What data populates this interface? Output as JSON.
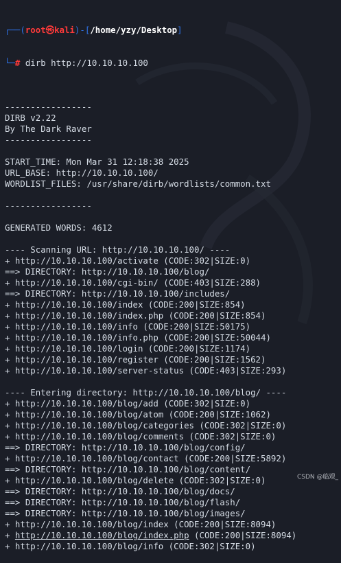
{
  "prompt": {
    "corner_top": "┌──(",
    "user": "root",
    "at_symbol": "㉿",
    "host": "kali",
    "sep": ")-[",
    "path": "/home/yzy/Desktop",
    "close": "]",
    "corner_bottom": "└─",
    "hash": "# ",
    "command": "dirb http://10.10.10.100"
  },
  "output": [
    "",
    "-----------------",
    "DIRB v2.22",
    "By The Dark Raver",
    "-----------------",
    "",
    "START_TIME: Mon Mar 31 12:18:38 2025",
    "URL_BASE: http://10.10.10.100/",
    "WORDLIST_FILES: /usr/share/dirb/wordlists/common.txt",
    "",
    "-----------------",
    "",
    "GENERATED WORDS: 4612",
    "",
    "---- Scanning URL: http://10.10.10.100/ ----",
    "+ http://10.10.10.100/activate (CODE:302|SIZE:0)",
    "==> DIRECTORY: http://10.10.10.100/blog/",
    "+ http://10.10.10.100/cgi-bin/ (CODE:403|SIZE:288)",
    "==> DIRECTORY: http://10.10.10.100/includes/",
    "+ http://10.10.10.100/index (CODE:200|SIZE:854)",
    "+ http://10.10.10.100/index.php (CODE:200|SIZE:854)",
    "+ http://10.10.10.100/info (CODE:200|SIZE:50175)",
    "+ http://10.10.10.100/info.php (CODE:200|SIZE:50044)",
    "+ http://10.10.10.100/login (CODE:200|SIZE:1174)",
    "+ http://10.10.10.100/register (CODE:200|SIZE:1562)",
    "+ http://10.10.10.100/server-status (CODE:403|SIZE:293)",
    "",
    "---- Entering directory: http://10.10.10.100/blog/ ----",
    "+ http://10.10.10.100/blog/add (CODE:302|SIZE:0)",
    "+ http://10.10.10.100/blog/atom (CODE:200|SIZE:1062)",
    "+ http://10.10.10.100/blog/categories (CODE:302|SIZE:0)",
    "+ http://10.10.10.100/blog/comments (CODE:302|SIZE:0)",
    "==> DIRECTORY: http://10.10.10.100/blog/config/",
    "+ http://10.10.10.100/blog/contact (CODE:200|SIZE:5892)",
    "==> DIRECTORY: http://10.10.10.100/blog/content/",
    "+ http://10.10.10.100/blog/delete (CODE:302|SIZE:0)",
    "==> DIRECTORY: http://10.10.10.100/blog/docs/",
    "==> DIRECTORY: http://10.10.10.100/blog/flash/",
    "==> DIRECTORY: http://10.10.10.100/blog/images/",
    "+ http://10.10.10.100/blog/index (CODE:200|SIZE:8094)",
    "+ http://10.10.10.100/blog/index.php (CODE:200|SIZE:8094)",
    "+ http://10.10.10.100/blog/info (CODE:302|SIZE:0)"
  ],
  "watermark": "CSDN @临观_",
  "colors": {
    "background": "#1b1e27",
    "prompt_blue": "#2f73e8",
    "prompt_red": "#ff3a3a",
    "text": "#d6dde6"
  }
}
